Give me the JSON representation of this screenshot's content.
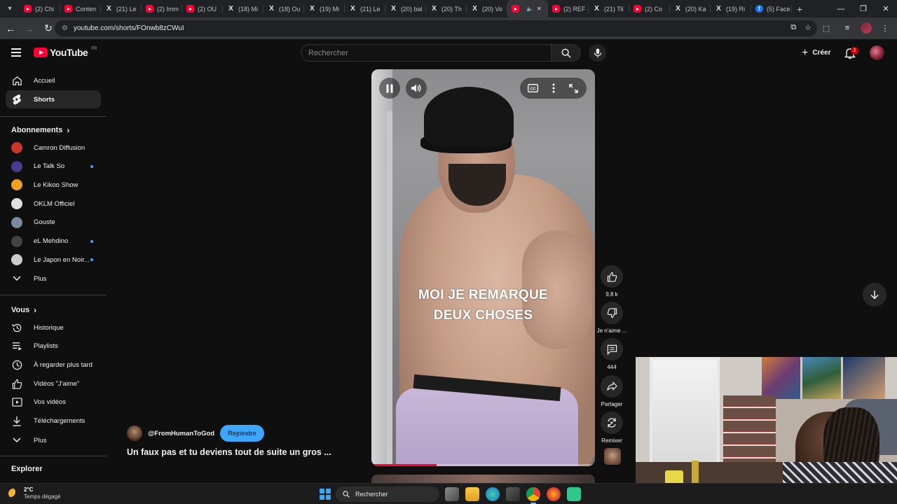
{
  "browser": {
    "tabs": [
      {
        "label": "(2) Chi",
        "favicon": "youtube-icon"
      },
      {
        "label": "Conten",
        "favicon": "youtube-icon"
      },
      {
        "label": "(21) Le",
        "favicon": "x-icon"
      },
      {
        "label": "(2) Imm",
        "favicon": "youtube-icon"
      },
      {
        "label": "(2) OU",
        "favicon": "youtube-icon"
      },
      {
        "label": "(18) Mi",
        "favicon": "x-icon"
      },
      {
        "label": "(18) Ou",
        "favicon": "x-icon"
      },
      {
        "label": "(19) Mi",
        "favicon": "x-icon"
      },
      {
        "label": "(21) Le",
        "favicon": "x-icon"
      },
      {
        "label": "(20) bal",
        "favicon": "x-icon"
      },
      {
        "label": "(20) Th",
        "favicon": "x-icon"
      },
      {
        "label": "(20) Vo",
        "favicon": "x-icon"
      },
      {
        "label": "",
        "favicon": "youtube-icon",
        "active": true
      },
      {
        "label": "(2) REF",
        "favicon": "youtube-icon"
      },
      {
        "label": "(21) Til",
        "favicon": "x-icon"
      },
      {
        "label": "(2) Co",
        "favicon": "youtube-icon"
      },
      {
        "label": "(20) Ka",
        "favicon": "x-icon"
      },
      {
        "label": "(19) Ri",
        "favicon": "x-icon"
      },
      {
        "label": "(5) Face",
        "favicon": "facebook-icon"
      }
    ],
    "url": "youtube.com/shorts/FOnwb8zCWuI"
  },
  "header": {
    "logo_text": "YouTube",
    "country_code": "FR",
    "search_placeholder": "Rechercher",
    "create_label": "Créer",
    "notification_count": "2"
  },
  "sidebar": {
    "main": [
      {
        "label": "Accueil",
        "icon": "home-icon"
      },
      {
        "label": "Shorts",
        "icon": "shorts-icon",
        "active": true
      }
    ],
    "subscriptions_title": "Abonnements",
    "subscriptions": [
      {
        "label": "Camron Diffusion",
        "color": "#c9372c",
        "new": false
      },
      {
        "label": "Le Talk So",
        "color": "#4b3a8c",
        "new": true
      },
      {
        "label": "Le Kikoo Show",
        "color": "#f0a020",
        "new": false
      },
      {
        "label": "OKLM Officiel",
        "color": "#e0e0e0",
        "new": false
      },
      {
        "label": "Gouste",
        "color": "#7a8aa0",
        "new": false
      },
      {
        "label": "eL Mehdino",
        "color": "#444444",
        "new": true
      },
      {
        "label": "Le Japon en Noir...",
        "color": "#cccccc",
        "new": true
      }
    ],
    "subscriptions_more": "Plus",
    "you_title": "Vous",
    "you_items": [
      {
        "label": "Historique",
        "icon": "history-icon"
      },
      {
        "label": "Playlists",
        "icon": "playlist-icon"
      },
      {
        "label": "À regarder plus tard",
        "icon": "clock-icon"
      },
      {
        "label": "Vidéos \"J'aime\"",
        "icon": "thumbs-up-icon"
      },
      {
        "label": "Vos vidéos",
        "icon": "video-icon"
      },
      {
        "label": "Téléchargements",
        "icon": "download-icon"
      }
    ],
    "you_more": "Plus",
    "explore_title": "Explorer"
  },
  "short": {
    "caption_line1": "MOI JE REMARQUE",
    "caption_line2": "DEUX CHOSES",
    "progress": 0.29,
    "channel": "@FromHumanToGod",
    "join_label": "Rejoindre",
    "title": "Un faux pas et tu deviens tout de suite un gros ...",
    "actions": {
      "likes": "9,8 k",
      "dislike_label": "Je n'aime ...",
      "comments": "444",
      "share_label": "Partager",
      "remix_label": "Remixer"
    }
  },
  "taskbar": {
    "temperature": "2°C",
    "condition": "Temps dégagé",
    "search_label": "Rechercher"
  }
}
